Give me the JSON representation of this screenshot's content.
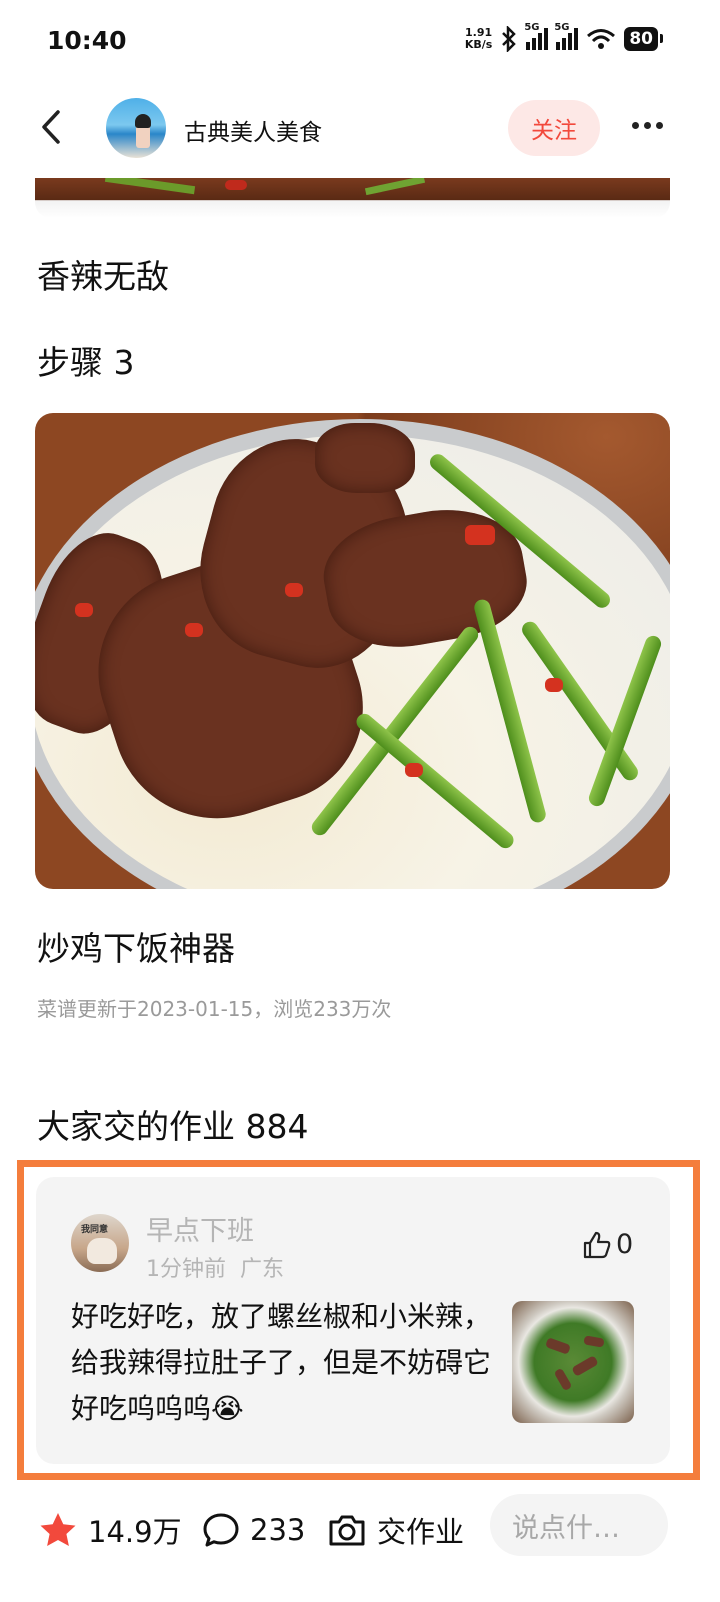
{
  "status_bar": {
    "time": "10:40",
    "net_speed_value": "1.91",
    "net_speed_unit": "KB/s",
    "signal1_label": "5G",
    "signal2_label": "5G",
    "battery": "80"
  },
  "header": {
    "author_name": "古典美人美食",
    "follow_label": "关注"
  },
  "content": {
    "line1": "香辣无敌",
    "step_title": "步骤 3",
    "step_caption": "炒鸡下饭神器",
    "meta": "菜谱更新于2023-01-15，浏览233万次",
    "homework_title": "大家交的作业 884"
  },
  "comment": {
    "avatar_tag": "我同意",
    "user_name": "早点下班",
    "time": "1分钟前",
    "location": "广东",
    "like_count": "0",
    "text": "好吃好吃，放了螺丝椒和小米辣，给我辣得拉肚子了，但是不妨碍它好吃呜呜呜😭"
  },
  "bottom_bar": {
    "favorites": "14.9万",
    "comments": "233",
    "homework_label": "交作业",
    "input_placeholder": "说点什…"
  },
  "colors": {
    "accent_red": "#f2493c",
    "follow_bg": "#fde8e6",
    "highlight_border": "#f47d3c",
    "star": "#f2493c"
  },
  "icons": [
    "back-arrow-icon",
    "more-dots-icon",
    "thumbs-up-icon",
    "star-icon",
    "comment-bubble-icon",
    "camera-icon",
    "bluetooth-icon",
    "wifi-icon"
  ]
}
